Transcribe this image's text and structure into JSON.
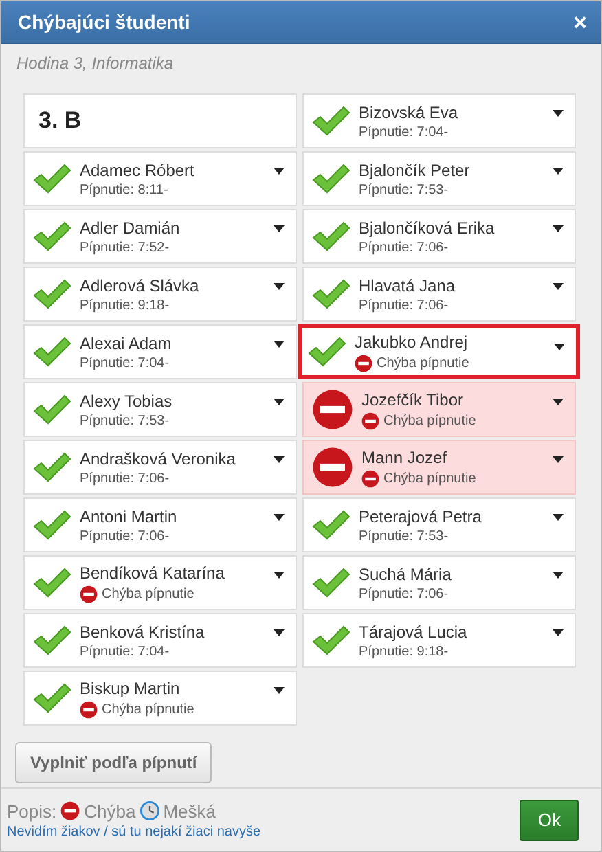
{
  "dialog": {
    "title": "Chýbajúci študenti",
    "close": "×"
  },
  "subtitle": "Hodina 3, Informatika",
  "class_label": "3. B",
  "columns": [
    [
      {
        "name": "Adamec Róbert",
        "kind": "present",
        "note_error": false,
        "note": "Pípnutie: 8:11-",
        "selected": false
      },
      {
        "name": "Adler Damián",
        "kind": "present",
        "note_error": false,
        "note": "Pípnutie: 7:52-",
        "selected": false
      },
      {
        "name": "Adlerová Slávka",
        "kind": "present",
        "note_error": false,
        "note": "Pípnutie: 9:18-",
        "selected": false
      },
      {
        "name": "Alexai Adam",
        "kind": "present",
        "note_error": false,
        "note": "Pípnutie: 7:04-",
        "selected": false
      },
      {
        "name": "Alexy Tobias",
        "kind": "present",
        "note_error": false,
        "note": "Pípnutie: 7:53-",
        "selected": false
      },
      {
        "name": "Andrašková Veronika",
        "kind": "present",
        "note_error": false,
        "note": "Pípnutie: 7:06-",
        "selected": false
      },
      {
        "name": "Antoni Martin",
        "kind": "present",
        "note_error": false,
        "note": "Pípnutie: 7:06-",
        "selected": false
      },
      {
        "name": "Bendíková Katarína",
        "kind": "present",
        "note_error": true,
        "note": "Chýba pípnutie",
        "selected": false
      },
      {
        "name": "Benková Kristína",
        "kind": "present",
        "note_error": false,
        "note": "Pípnutie: 7:04-",
        "selected": false
      },
      {
        "name": "Biskup Martin",
        "kind": "present",
        "note_error": true,
        "note": "Chýba pípnutie",
        "selected": false
      }
    ],
    [
      {
        "name": "Bizovská Eva",
        "kind": "present",
        "note_error": false,
        "note": "Pípnutie: 7:04-",
        "selected": false
      },
      {
        "name": "Bjalončík Peter",
        "kind": "present",
        "note_error": false,
        "note": "Pípnutie: 7:53-",
        "selected": false
      },
      {
        "name": "Bjalončíková Erika",
        "kind": "present",
        "note_error": false,
        "note": "Pípnutie: 7:06-",
        "selected": false
      },
      {
        "name": "Hlavatá Jana",
        "kind": "present",
        "note_error": false,
        "note": "Pípnutie: 7:06-",
        "selected": false
      },
      {
        "name": "Jakubko Andrej",
        "kind": "present",
        "note_error": true,
        "note": "Chýba pípnutie",
        "selected": true
      },
      {
        "name": "Jozefčík Tibor",
        "kind": "absent",
        "note_error": true,
        "note": "Chýba pípnutie",
        "selected": false
      },
      {
        "name": "Mann Jozef",
        "kind": "absent",
        "note_error": true,
        "note": "Chýba pípnutie",
        "selected": false
      },
      {
        "name": "Peterajová Petra",
        "kind": "present",
        "note_error": false,
        "note": "Pípnutie: 7:53-",
        "selected": false
      },
      {
        "name": "Suchá Mária",
        "kind": "present",
        "note_error": false,
        "note": "Pípnutie: 7:06-",
        "selected": false
      },
      {
        "name": "Tárajová Lucia",
        "kind": "present",
        "note_error": false,
        "note": "Pípnutie: 9:18-",
        "selected": false
      }
    ]
  ],
  "fill_button": "Vyplniť podľa pípnutí",
  "legend": {
    "label": "Popis:",
    "absent": "Chýba",
    "late": "Mešká"
  },
  "link": "Nevidím žiakov / sú tu nejakí žiaci navyše",
  "ok_button": "Ok"
}
